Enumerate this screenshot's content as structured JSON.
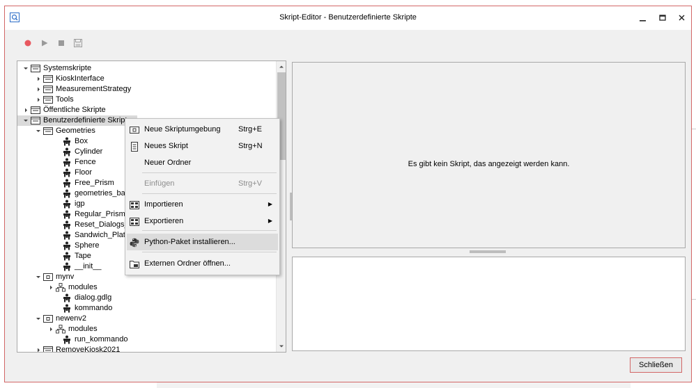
{
  "window": {
    "title": "Skript-Editor - Benutzerdefinierte Skripte",
    "minimize_label": "Minimieren",
    "maximize_label": "Maximieren",
    "close_label": "Schließen"
  },
  "toolbar": {
    "buttons": [
      {
        "name": "record",
        "icon": "record-icon",
        "color": "#e8585f"
      },
      {
        "name": "run",
        "icon": "play-icon",
        "color": "#9a9a9a"
      },
      {
        "name": "stop",
        "icon": "stop-icon",
        "color": "#9a9a9a"
      },
      {
        "name": "save",
        "icon": "save-icon",
        "color": "#9a9a9a"
      }
    ]
  },
  "tree": {
    "items": [
      {
        "label": "Systemskripte",
        "toggle": "expanded"
      },
      {
        "label": "KioskInterface",
        "toggle": "collapsed"
      },
      {
        "label": "MeasurementStrategy",
        "toggle": "collapsed"
      },
      {
        "label": "Tools",
        "toggle": "collapsed"
      },
      {
        "label": "Öffentliche Skripte",
        "toggle": "collapsed"
      },
      {
        "label": "Benutzerdefinierte Skripte",
        "toggle": "expanded"
      },
      {
        "label": "Geometries",
        "toggle": "expanded"
      },
      {
        "label": "Box",
        "toggle": "none"
      },
      {
        "label": "Cylinder",
        "toggle": "none"
      },
      {
        "label": "Fence",
        "toggle": "none"
      },
      {
        "label": "Floor",
        "toggle": "none"
      },
      {
        "label": "Free_Prism",
        "toggle": "none"
      },
      {
        "label": "geometries_base",
        "toggle": "none"
      },
      {
        "label": "igp",
        "toggle": "none"
      },
      {
        "label": "Regular_Prism",
        "toggle": "none"
      },
      {
        "label": "Reset_Dialogs_t",
        "toggle": "none"
      },
      {
        "label": "Sandwich_Plate",
        "toggle": "none"
      },
      {
        "label": "Sphere",
        "toggle": "none"
      },
      {
        "label": "Tape",
        "toggle": "none"
      },
      {
        "label": "__init__",
        "toggle": "none"
      },
      {
        "label": "mynv",
        "toggle": "expanded"
      },
      {
        "label": "modules",
        "toggle": "collapsed"
      },
      {
        "label": "dialog.gdlg",
        "toggle": "none"
      },
      {
        "label": "kommando",
        "toggle": "none"
      },
      {
        "label": "newenv2",
        "toggle": "expanded"
      },
      {
        "label": "modules",
        "toggle": "collapsed"
      },
      {
        "label": "run_kommando",
        "toggle": "none"
      },
      {
        "label": "RemoveKiosk2021",
        "toggle": "collapsed"
      }
    ]
  },
  "preview": {
    "empty_message": "Es gibt kein Skript, das angezeigt werden kann."
  },
  "context_menu": {
    "items": [
      {
        "label": "Neue Skriptumgebung",
        "shortcut": "Strg+E",
        "icon": "environment-icon"
      },
      {
        "label": "Neues Skript",
        "shortcut": "Strg+N",
        "icon": "script-file-icon"
      },
      {
        "label": "Neuer Ordner",
        "shortcut": "",
        "icon": ""
      },
      {
        "label": "Einfügen",
        "shortcut": "Strg+V",
        "icon": "",
        "disabled": true
      },
      {
        "label": "Importieren",
        "shortcut": "",
        "icon": "import-icon",
        "submenu": true
      },
      {
        "label": "Exportieren",
        "shortcut": "",
        "icon": "export-icon",
        "submenu": true
      },
      {
        "label": "Python-Paket installieren...",
        "shortcut": "",
        "icon": "python-icon",
        "highlighted": true
      },
      {
        "label": "Externen Ordner öffnen...",
        "shortcut": "",
        "icon": "open-folder-icon"
      }
    ]
  },
  "footer": {
    "close_button": "Schließen"
  }
}
